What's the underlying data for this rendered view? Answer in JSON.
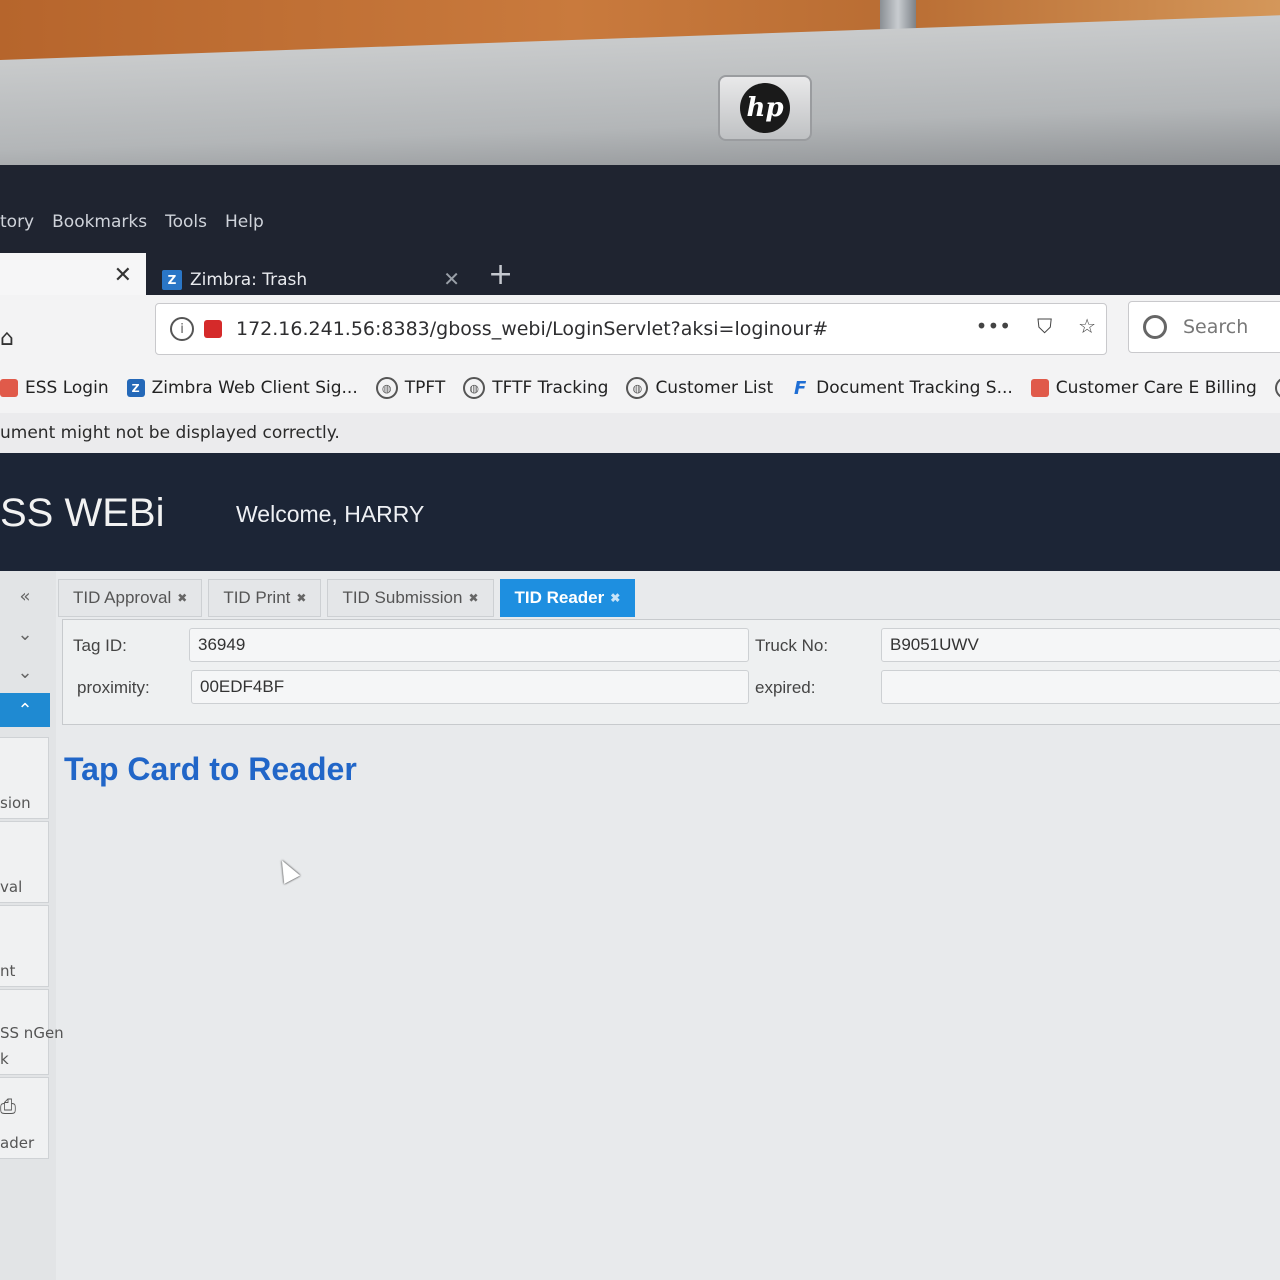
{
  "hardware": {
    "brand_logo": "hp"
  },
  "menu": {
    "history": "tory",
    "bookmarks": "Bookmarks",
    "tools": "Tools",
    "help": "Help"
  },
  "browser_tabs": {
    "active_tab_title": "Zimbra: Trash",
    "close": "✕",
    "new_tab": "+"
  },
  "address_bar": {
    "url": "172.16.241.56:8383/gboss_webi/LoginServlet?aksi=loginour#",
    "more": "•••"
  },
  "search": {
    "placeholder": "Search"
  },
  "bookmarks": [
    {
      "label": "ESS Login",
      "icon": "ess-icon"
    },
    {
      "label": "Zimbra Web Client Sig...",
      "icon": "zimbra-icon"
    },
    {
      "label": "TPFT",
      "icon": "globe-icon"
    },
    {
      "label": "TFTF Tracking",
      "icon": "globe-icon"
    },
    {
      "label": "Customer List",
      "icon": "globe-icon"
    },
    {
      "label": "Document Tracking S...",
      "icon": "f-icon"
    },
    {
      "label": "Customer Care E Billing",
      "icon": "billing-icon"
    }
  ],
  "notice": "ument might not be displayed correctly.",
  "app": {
    "brand": "SS WEBi",
    "welcome": "Welcome, HARRY"
  },
  "sidebar": {
    "collapse": "«",
    "ctl_1": "⌄",
    "ctl_2": "⌄",
    "ctl_3": "⌃",
    "cards": [
      {
        "label": "sion"
      },
      {
        "label": "val"
      },
      {
        "label": "nt"
      },
      {
        "label": "SS nGen"
      },
      {
        "label": "k"
      },
      {
        "label": "ader"
      }
    ]
  },
  "tabs": [
    {
      "label": "TID Approval",
      "close": "✖",
      "active": false
    },
    {
      "label": "TID Print",
      "close": "✖",
      "active": false
    },
    {
      "label": "TID Submission",
      "close": "✖",
      "active": false
    },
    {
      "label": "TID Reader",
      "close": "✖",
      "active": true
    }
  ],
  "form": {
    "tag_id": {
      "label": "Tag ID:",
      "value": "36949"
    },
    "truck_no": {
      "label": "Truck No:",
      "value": "B9051UWV"
    },
    "proximity": {
      "label": "proximity:",
      "value": "00EDF4BF"
    },
    "expired": {
      "label": "expired:",
      "value": ""
    }
  },
  "message": "Tap Card to Reader",
  "colors": {
    "header_bg": "#1c2536",
    "accent": "#1e8fe0",
    "message": "#2166c8"
  }
}
